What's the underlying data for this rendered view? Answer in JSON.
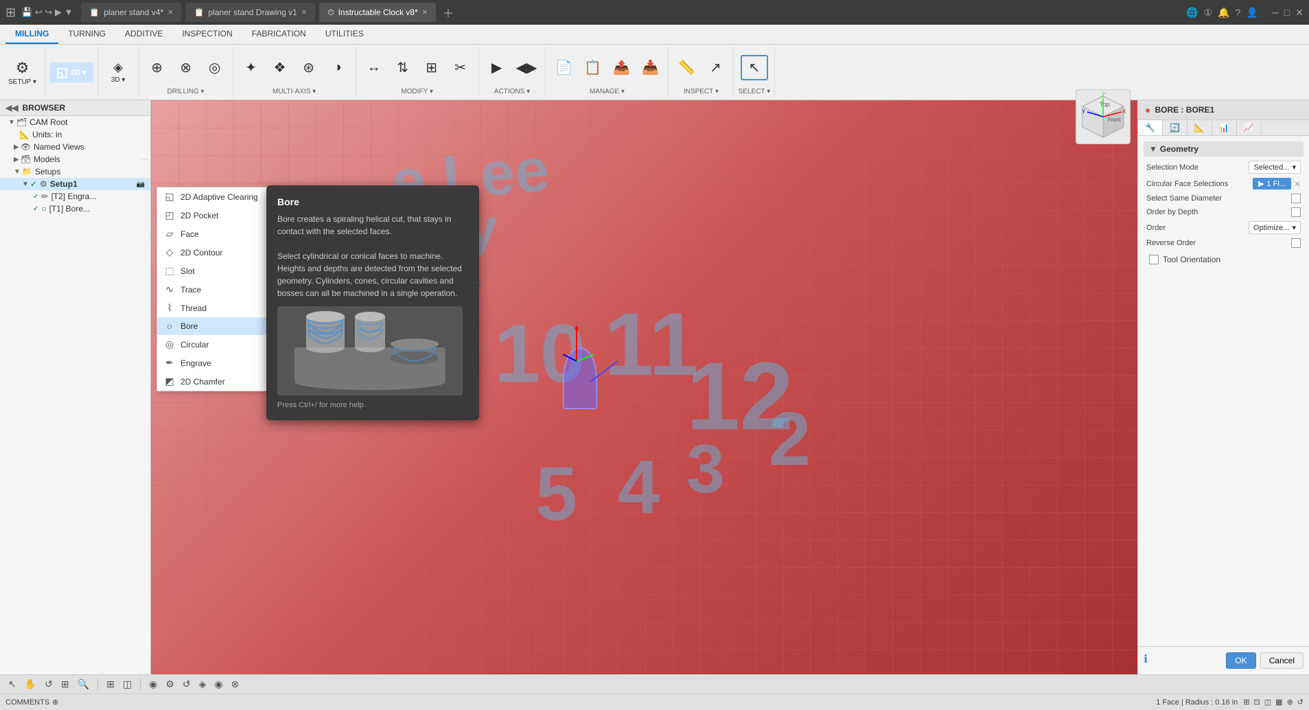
{
  "titlebar": {
    "app_icon": "⊞",
    "tabs": [
      {
        "label": "planer stand v4*",
        "active": false,
        "icon": "📋"
      },
      {
        "label": "planer stand Drawing v1",
        "active": false,
        "icon": "📋"
      },
      {
        "label": "Instructable Clock v8*",
        "active": true,
        "icon": "⏱"
      }
    ],
    "actions": [
      "🌐",
      "①",
      "🔔",
      "?",
      "👤"
    ]
  },
  "ribbon": {
    "tabs": [
      "MILLING",
      "TURNING",
      "ADDITIVE",
      "INSPECTION",
      "FABRICATION",
      "UTILITIES"
    ],
    "active_tab": "MILLING",
    "groups": [
      {
        "label": "SETUP",
        "buttons": [
          {
            "icon": "⚙",
            "label": "SETUP"
          }
        ]
      },
      {
        "label": "2D",
        "active": true,
        "buttons": [
          {
            "icon": "◱",
            "label": "2D"
          }
        ]
      },
      {
        "label": "3D",
        "buttons": [
          {
            "icon": "◈",
            "label": "3D"
          }
        ]
      },
      {
        "label": "DRILLING",
        "buttons": [
          {
            "icon": "⊕",
            "label": "DRILLING"
          }
        ]
      },
      {
        "label": "MULTI-AXIS",
        "buttons": [
          {
            "icon": "✦",
            "label": "MULTI-AXIS"
          }
        ]
      },
      {
        "label": "MODIFY",
        "buttons": [
          {
            "icon": "↔",
            "label": "MODIFY"
          }
        ]
      },
      {
        "label": "ACTIONS",
        "buttons": [
          {
            "icon": "▶",
            "label": "ACTIONS"
          }
        ]
      },
      {
        "label": "MANAGE",
        "buttons": [
          {
            "icon": "📄",
            "label": "MANAGE"
          }
        ]
      },
      {
        "label": "INSPECT",
        "buttons": [
          {
            "icon": "📏",
            "label": "INSPECT"
          }
        ]
      },
      {
        "label": "SELECT",
        "buttons": [
          {
            "icon": "↖",
            "label": "SELECT"
          }
        ]
      }
    ]
  },
  "sidebar": {
    "header": "BROWSER",
    "items": [
      {
        "label": "CAM Root",
        "level": 0,
        "icon": "🗂",
        "expanded": true
      },
      {
        "label": "Units: in",
        "level": 1,
        "icon": "📐",
        "expanded": false
      },
      {
        "label": "Named Views",
        "level": 1,
        "icon": "👁",
        "expanded": false
      },
      {
        "label": "Models",
        "level": 1,
        "icon": "🗃",
        "expanded": false
      },
      {
        "label": "Setups",
        "level": 1,
        "icon": "📁",
        "expanded": true
      },
      {
        "label": "Setup1",
        "level": 2,
        "icon": "⚙",
        "expanded": true,
        "special": true
      },
      {
        "label": "[T2] Engra...",
        "level": 3,
        "icon": "✏"
      },
      {
        "label": "[T1] Bore...",
        "level": 3,
        "icon": "○"
      }
    ]
  },
  "dropdown": {
    "title": "2D",
    "items": [
      {
        "label": "2D Adaptive Clearing",
        "icon": "◱",
        "active": false
      },
      {
        "label": "2D Pocket",
        "icon": "◰",
        "active": false
      },
      {
        "label": "Face",
        "icon": "▱",
        "active": false
      },
      {
        "label": "2D Contour",
        "icon": "◇",
        "active": false
      },
      {
        "label": "Slot",
        "icon": "⬚",
        "active": false
      },
      {
        "label": "Trace",
        "icon": "∿",
        "active": false
      },
      {
        "label": "Thread",
        "icon": "⌇",
        "active": false
      },
      {
        "label": "Bore",
        "icon": "○",
        "active": true,
        "has_more": true
      },
      {
        "label": "Circular",
        "icon": "◎",
        "active": false
      },
      {
        "label": "Engrave",
        "icon": "✒",
        "active": false
      },
      {
        "label": "2D Chamfer",
        "icon": "◩",
        "active": false
      }
    ]
  },
  "tooltip": {
    "title": "Bore",
    "description": "Bore creates a spiraling helical cut, that stays in contact with the selected faces.\n\nSelect cylindrical or conical faces to machine. Heights and depths are detected from the selected geometry. Cylinders, cones, circular cavities and bosses can all be machined in a single operation.",
    "footer": "Press Ctrl+/ for more help."
  },
  "right_panel": {
    "header": "BORE : BORE1",
    "header_icon": "●",
    "section": "Geometry",
    "fields": [
      {
        "label": "Selection Mode",
        "type": "select",
        "value": "Selected..."
      },
      {
        "label": "Circular Face Selections",
        "type": "tag",
        "value": "1 Fl...",
        "has_close": true
      },
      {
        "label": "Select Same Diameter",
        "type": "checkbox",
        "checked": false
      },
      {
        "label": "Order by Depth",
        "type": "checkbox",
        "checked": false
      },
      {
        "label": "Order",
        "type": "select",
        "value": "Optimize..."
      },
      {
        "label": "Reverse Order",
        "type": "checkbox",
        "checked": false
      }
    ],
    "tool_orientation": {
      "label": "Tool Orientation",
      "checked": false
    },
    "buttons": {
      "info": "ℹ",
      "ok": "OK",
      "cancel": "Cancel"
    }
  },
  "statusbar": {
    "left": "COMMENTS",
    "right": "1 Face | Radius : 0.16 in",
    "icons": [
      "⊞",
      "⊡",
      "◫",
      "▦",
      "⊕",
      "↺",
      "◈",
      "◉",
      "⊗"
    ]
  },
  "nav_cube": {
    "label": "Front"
  }
}
